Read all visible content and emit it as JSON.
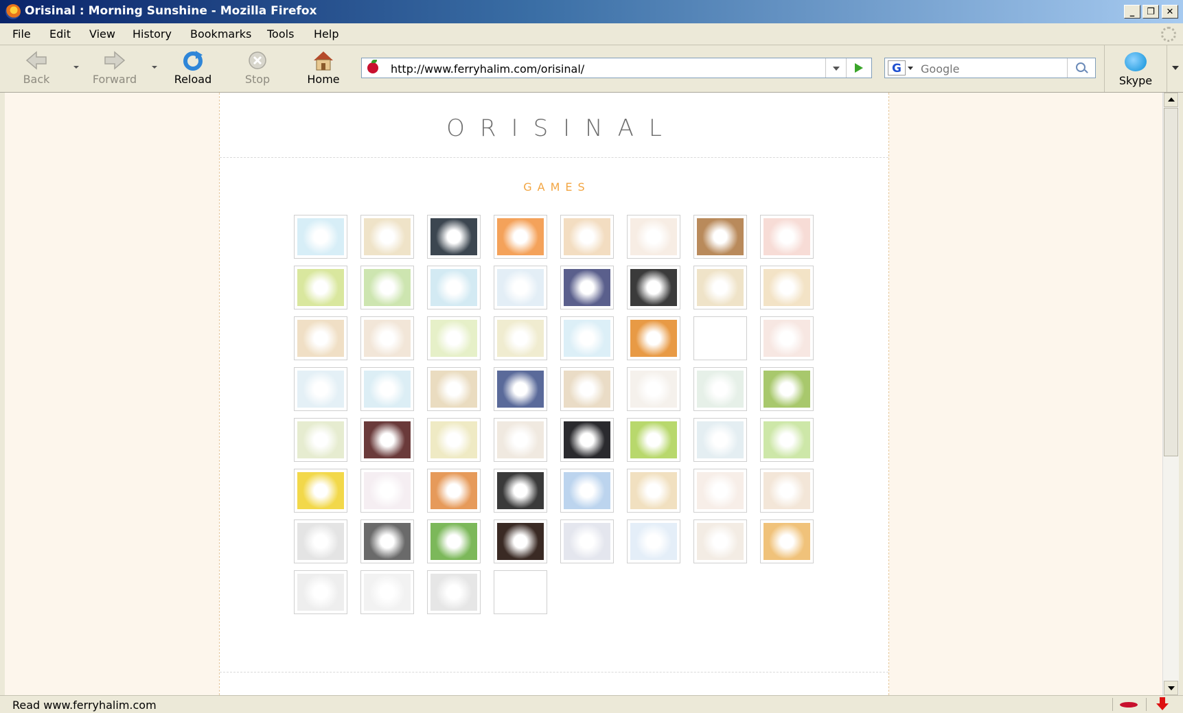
{
  "window": {
    "title": "Orisinal : Morning Sunshine - Mozilla Firefox",
    "controls": [
      "minimize",
      "restore",
      "close"
    ]
  },
  "menu": [
    "File",
    "Edit",
    "View",
    "History",
    "Bookmarks",
    "Tools",
    "Help"
  ],
  "toolbar": {
    "back": "Back",
    "forward": "Forward",
    "reload": "Reload",
    "stop": "Stop",
    "home": "Home",
    "url": "http://www.ferryhalim.com/orisinal/",
    "search_placeholder": "Google",
    "skype": "Skype"
  },
  "page": {
    "logo": "ORISINAL",
    "heading": "GAMES",
    "games": [
      {
        "icon": "sun-icon",
        "c": "#d7eef7"
      },
      {
        "icon": "sunrise-icon",
        "c": "#efe3c8"
      },
      {
        "icon": "bell-icon",
        "c": "#3c4650"
      },
      {
        "icon": "orange-circle-icon",
        "c": "#f4a25a"
      },
      {
        "icon": "puppy-icon",
        "c": "#f3ddc1"
      },
      {
        "icon": "window-apple-icon",
        "c": "#f7ede4"
      },
      {
        "icon": "teapot-icon",
        "c": "#b98a5b"
      },
      {
        "icon": "flower-icon",
        "c": "#f7dcd6"
      },
      {
        "icon": "monkey-icon",
        "c": "#d9e79e"
      },
      {
        "icon": "leaf-mouse-icon",
        "c": "#cde5b0"
      },
      {
        "icon": "ladybug-icon",
        "c": "#d3eaf3"
      },
      {
        "icon": "swan-icon",
        "c": "#e3eef6"
      },
      {
        "icon": "star-icon",
        "c": "#5a5f8c"
      },
      {
        "icon": "cats-icon",
        "c": "#3b3b3b"
      },
      {
        "icon": "hedgehog-icon",
        "c": "#efe3c8"
      },
      {
        "icon": "lion-icon",
        "c": "#f3e3c6"
      },
      {
        "icon": "runner-icon",
        "c": "#f0dfc5"
      },
      {
        "icon": "boy-icon",
        "c": "#f2e6d8"
      },
      {
        "icon": "tree-icon",
        "c": "#e6f0c8"
      },
      {
        "icon": "bird-icon",
        "c": "#f0ecd0"
      },
      {
        "icon": "boat-icon",
        "c": "#dceff7"
      },
      {
        "icon": "nest-icon",
        "c": "#e89a45"
      },
      {
        "icon": "panda-face-icon",
        "c": "#ffffff"
      },
      {
        "icon": "pig-icon",
        "c": "#f7e7e2"
      },
      {
        "icon": "angel-icon",
        "c": "#e4f0f6"
      },
      {
        "icon": "sea-urchin-icon",
        "c": "#dceef5"
      },
      {
        "icon": "owl-icon",
        "c": "#eadcc0"
      },
      {
        "icon": "blue-bear-icon",
        "c": "#5a6a9a"
      },
      {
        "icon": "bear-icon",
        "c": "#eadcc6"
      },
      {
        "icon": "kite-icon",
        "c": "#f5f1ec"
      },
      {
        "icon": "mouse-icon",
        "c": "#e6f0e8"
      },
      {
        "icon": "dragonfly-icon",
        "c": "#a8c86c"
      },
      {
        "icon": "raccoon-icon",
        "c": "#e6ecd0"
      },
      {
        "icon": "colored-squares-icon",
        "c": "#6a3a3a"
      },
      {
        "icon": "chick-icon",
        "c": "#efeac4"
      },
      {
        "icon": "ship-icon",
        "c": "#f0e9e0"
      },
      {
        "icon": "moon-icon",
        "c": "#2a2a2e"
      },
      {
        "icon": "frog-icon",
        "c": "#b8d86c"
      },
      {
        "icon": "koala-icon",
        "c": "#e4eef2"
      },
      {
        "icon": "umbrella-pigs-icon",
        "c": "#cde7a8"
      },
      {
        "icon": "bee-icon",
        "c": "#f2d84a"
      },
      {
        "icon": "snow-child-icon",
        "c": "#f5eef2"
      },
      {
        "icon": "fox-icon",
        "c": "#e69a5a"
      },
      {
        "icon": "moose-icon",
        "c": "#3a3a3a"
      },
      {
        "icon": "ufo-icon",
        "c": "#bcd4ee"
      },
      {
        "icon": "start-basket-icon",
        "c": "#f1e0c0"
      },
      {
        "icon": "crab-icon",
        "c": "#f7eee8"
      },
      {
        "icon": "balloon-icon",
        "c": "#f3e6d8"
      },
      {
        "icon": "ninja-icon",
        "c": "#e4e4e4"
      },
      {
        "icon": "speaker-icon",
        "c": "#6a6a6a"
      },
      {
        "icon": "cow-icon",
        "c": "#7cb85a"
      },
      {
        "icon": "ball-icon",
        "c": "#3a2a24"
      },
      {
        "icon": "robot-icon",
        "c": "#e4e6ee"
      },
      {
        "icon": "penguin-icon",
        "c": "#e4eef8"
      },
      {
        "icon": "karate-icon",
        "c": "#f3ece4"
      },
      {
        "icon": "warship-icon",
        "c": "#f0c27a"
      },
      {
        "icon": "rocket-icon",
        "c": "#eeeeee"
      },
      {
        "icon": "snowman-icon",
        "c": "#f2f2f2"
      },
      {
        "icon": "girl-face-icon",
        "c": "#e6e6e6"
      },
      {
        "icon": "apple-icon",
        "c": "#ffffff"
      }
    ]
  },
  "status": "Read www.ferryhalim.com"
}
